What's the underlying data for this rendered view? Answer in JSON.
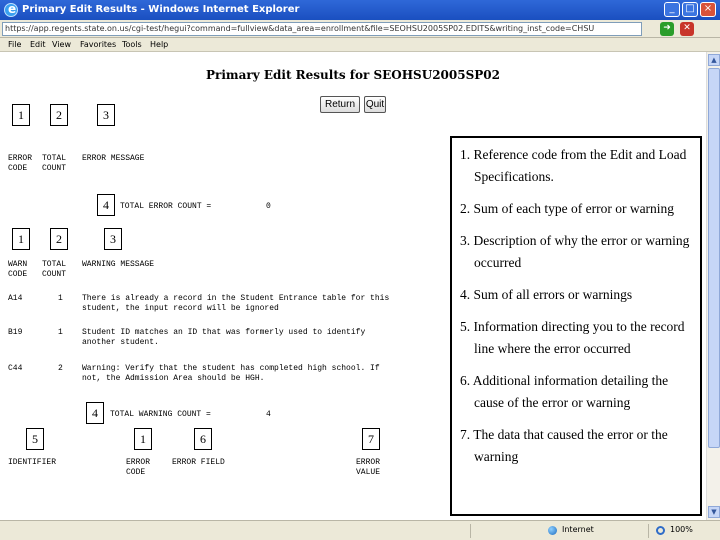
{
  "window": {
    "title": "Primary Edit Results - Windows Internet Explorer",
    "minimize": "_",
    "maximize": "□",
    "close": "×"
  },
  "address": {
    "url": "https://app.regents.state.on.us/cgi-test/hegui?command=fullview&data_area=enrollment&file=SEOHSU2005SP02.EDITS&writing_inst_code=CHSU"
  },
  "menu": [
    "File",
    "Edit",
    "View",
    "Favorites",
    "Tools",
    "Help"
  ],
  "page": {
    "title": "Primary Edit Results for SEOHSU2005SP02",
    "return_label": "Return",
    "quit_label": "Quit"
  },
  "markers": {
    "n1": "1",
    "n2": "2",
    "n3": "3",
    "n4": "4",
    "n5": "5",
    "n6": "6",
    "n7": "7"
  },
  "errors": {
    "col_code": "ERROR\nCODE",
    "col_count": "TOTAL\nCOUNT",
    "col_message": "ERROR MESSAGE",
    "total_label": "TOTAL ERROR COUNT =",
    "total_value": "0"
  },
  "warnings": {
    "col_code": "WARN\nCODE",
    "col_count": "TOTAL\nCOUNT",
    "col_message": "WARNING MESSAGE",
    "rows": [
      {
        "code": "A14",
        "count": "1",
        "message": "There is already a record in the Student Entrance table for this\nstudent, the input record will be ignored"
      },
      {
        "code": "B19",
        "count": "1",
        "message": "Student ID matches an ID that was formerly used to identify\nanother student."
      },
      {
        "code": "C44",
        "count": "2",
        "message": "Warning: Verify that the student has completed high school. If\nnot, the Admission Area should be HGH."
      }
    ],
    "total_label": "TOTAL WARNING COUNT =",
    "total_value": "4"
  },
  "detail_headers": {
    "identifier": "IDENTIFIER",
    "error_code": "ERROR\nCODE",
    "error_field": "ERROR FIELD",
    "error_value": "ERROR\nVALUE"
  },
  "callout": [
    "1. Reference code from the Edit and Load Specifications.",
    "2. Sum of each type of error or warning",
    "3. Description of why the error or warning occurred",
    "4. Sum of all errors or warnings",
    "5. Information directing you to the record line where the error occurred",
    "6. Additional information detailing the cause of the  error or warning",
    "7. The data that caused the error or the warning"
  ],
  "status": {
    "zone": "Internet",
    "zoom": "100%"
  }
}
